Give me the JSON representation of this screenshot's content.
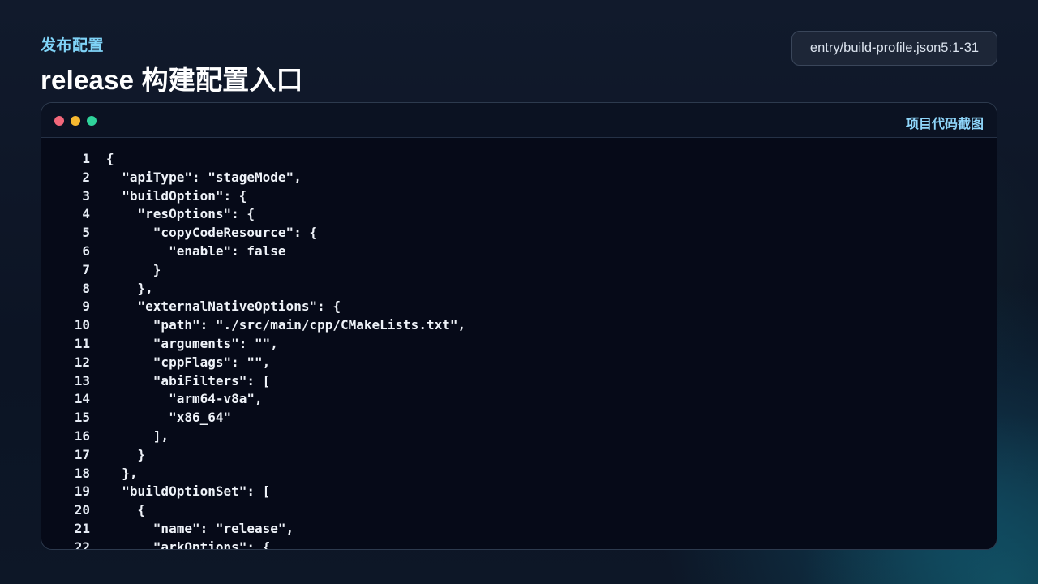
{
  "header": {
    "eyebrow": "发布配置",
    "title": "release 构建配置入口",
    "file_ref": "entry/build-profile.json5:1-31"
  },
  "code_panel": {
    "label": "项目代码截图",
    "window_dots": [
      "close",
      "minimize",
      "maximize"
    ],
    "colors": {
      "close": "#f2677a",
      "minimize": "#f6b830",
      "maximize": "#2fd39b"
    },
    "lines": [
      {
        "no": "1",
        "text": "{"
      },
      {
        "no": "2",
        "text": "  \"apiType\": \"stageMode\","
      },
      {
        "no": "3",
        "text": "  \"buildOption\": {"
      },
      {
        "no": "4",
        "text": "    \"resOptions\": {"
      },
      {
        "no": "5",
        "text": "      \"copyCodeResource\": {"
      },
      {
        "no": "6",
        "text": "        \"enable\": false"
      },
      {
        "no": "7",
        "text": "      }"
      },
      {
        "no": "8",
        "text": "    },"
      },
      {
        "no": "9",
        "text": "    \"externalNativeOptions\": {"
      },
      {
        "no": "10",
        "text": "      \"path\": \"./src/main/cpp/CMakeLists.txt\","
      },
      {
        "no": "11",
        "text": "      \"arguments\": \"\","
      },
      {
        "no": "12",
        "text": "      \"cppFlags\": \"\","
      },
      {
        "no": "13",
        "text": "      \"abiFilters\": ["
      },
      {
        "no": "14",
        "text": "        \"arm64-v8a\","
      },
      {
        "no": "15",
        "text": "        \"x86_64\""
      },
      {
        "no": "16",
        "text": "      ],"
      },
      {
        "no": "17",
        "text": "    }"
      },
      {
        "no": "18",
        "text": "  },"
      },
      {
        "no": "19",
        "text": "  \"buildOptionSet\": ["
      },
      {
        "no": "20",
        "text": "    {"
      },
      {
        "no": "21",
        "text": "      \"name\": \"release\","
      },
      {
        "no": "22",
        "text": "      \"arkOptions\": {"
      }
    ]
  }
}
